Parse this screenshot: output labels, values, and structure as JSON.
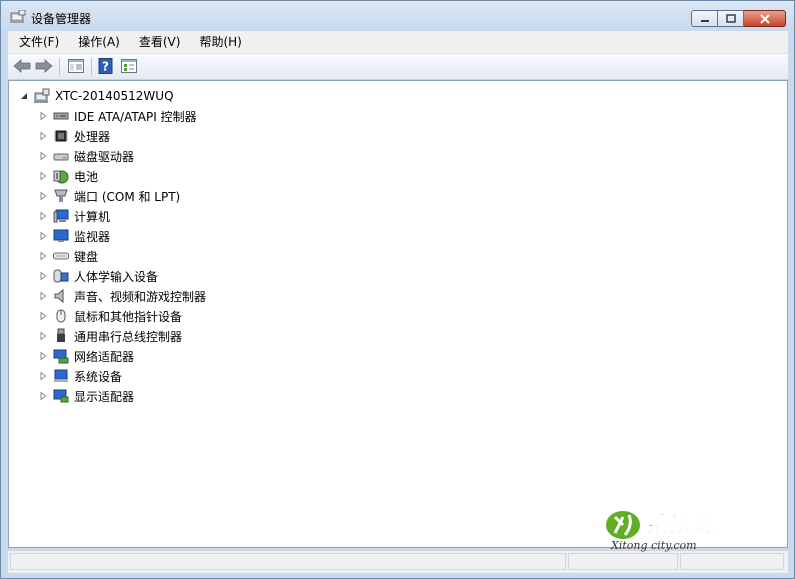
{
  "window": {
    "title": "设备管理器"
  },
  "menu": [
    {
      "label": "文件(F)"
    },
    {
      "label": "操作(A)"
    },
    {
      "label": "查看(V)"
    },
    {
      "label": "帮助(H)"
    }
  ],
  "toolbar": {
    "buttons": [
      {
        "icon": "back-arrow-icon"
      },
      {
        "icon": "forward-arrow-icon"
      },
      {
        "icon": "show-hide-console-tree-icon"
      },
      {
        "icon": "help-icon"
      },
      {
        "icon": "properties-icon"
      }
    ]
  },
  "tree": {
    "root": "XTC-20140512WUQ",
    "items": [
      {
        "label": "IDE ATA/ATAPI 控制器",
        "icon": "ide-controller-icon"
      },
      {
        "label": "处理器",
        "icon": "processor-icon"
      },
      {
        "label": "磁盘驱动器",
        "icon": "disk-drive-icon"
      },
      {
        "label": "电池",
        "icon": "battery-icon"
      },
      {
        "label": "端口 (COM 和 LPT)",
        "icon": "port-icon"
      },
      {
        "label": "计算机",
        "icon": "computer-icon"
      },
      {
        "label": "监视器",
        "icon": "monitor-icon"
      },
      {
        "label": "键盘",
        "icon": "keyboard-icon"
      },
      {
        "label": "人体学输入设备",
        "icon": "hid-icon"
      },
      {
        "label": "声音、视频和游戏控制器",
        "icon": "sound-icon"
      },
      {
        "label": "鼠标和其他指针设备",
        "icon": "mouse-icon"
      },
      {
        "label": "通用串行总线控制器",
        "icon": "usb-icon"
      },
      {
        "label": "网络适配器",
        "icon": "network-adapter-icon"
      },
      {
        "label": "系统设备",
        "icon": "system-device-icon"
      },
      {
        "label": "显示适配器",
        "icon": "display-adapter-icon"
      }
    ]
  },
  "watermark": {
    "brand": "系统城",
    "domain": "Xitong city.com"
  },
  "colors": {
    "accent": "#2a6ad0",
    "close": "#c7432a",
    "watermark_green": "#4aa21a"
  }
}
